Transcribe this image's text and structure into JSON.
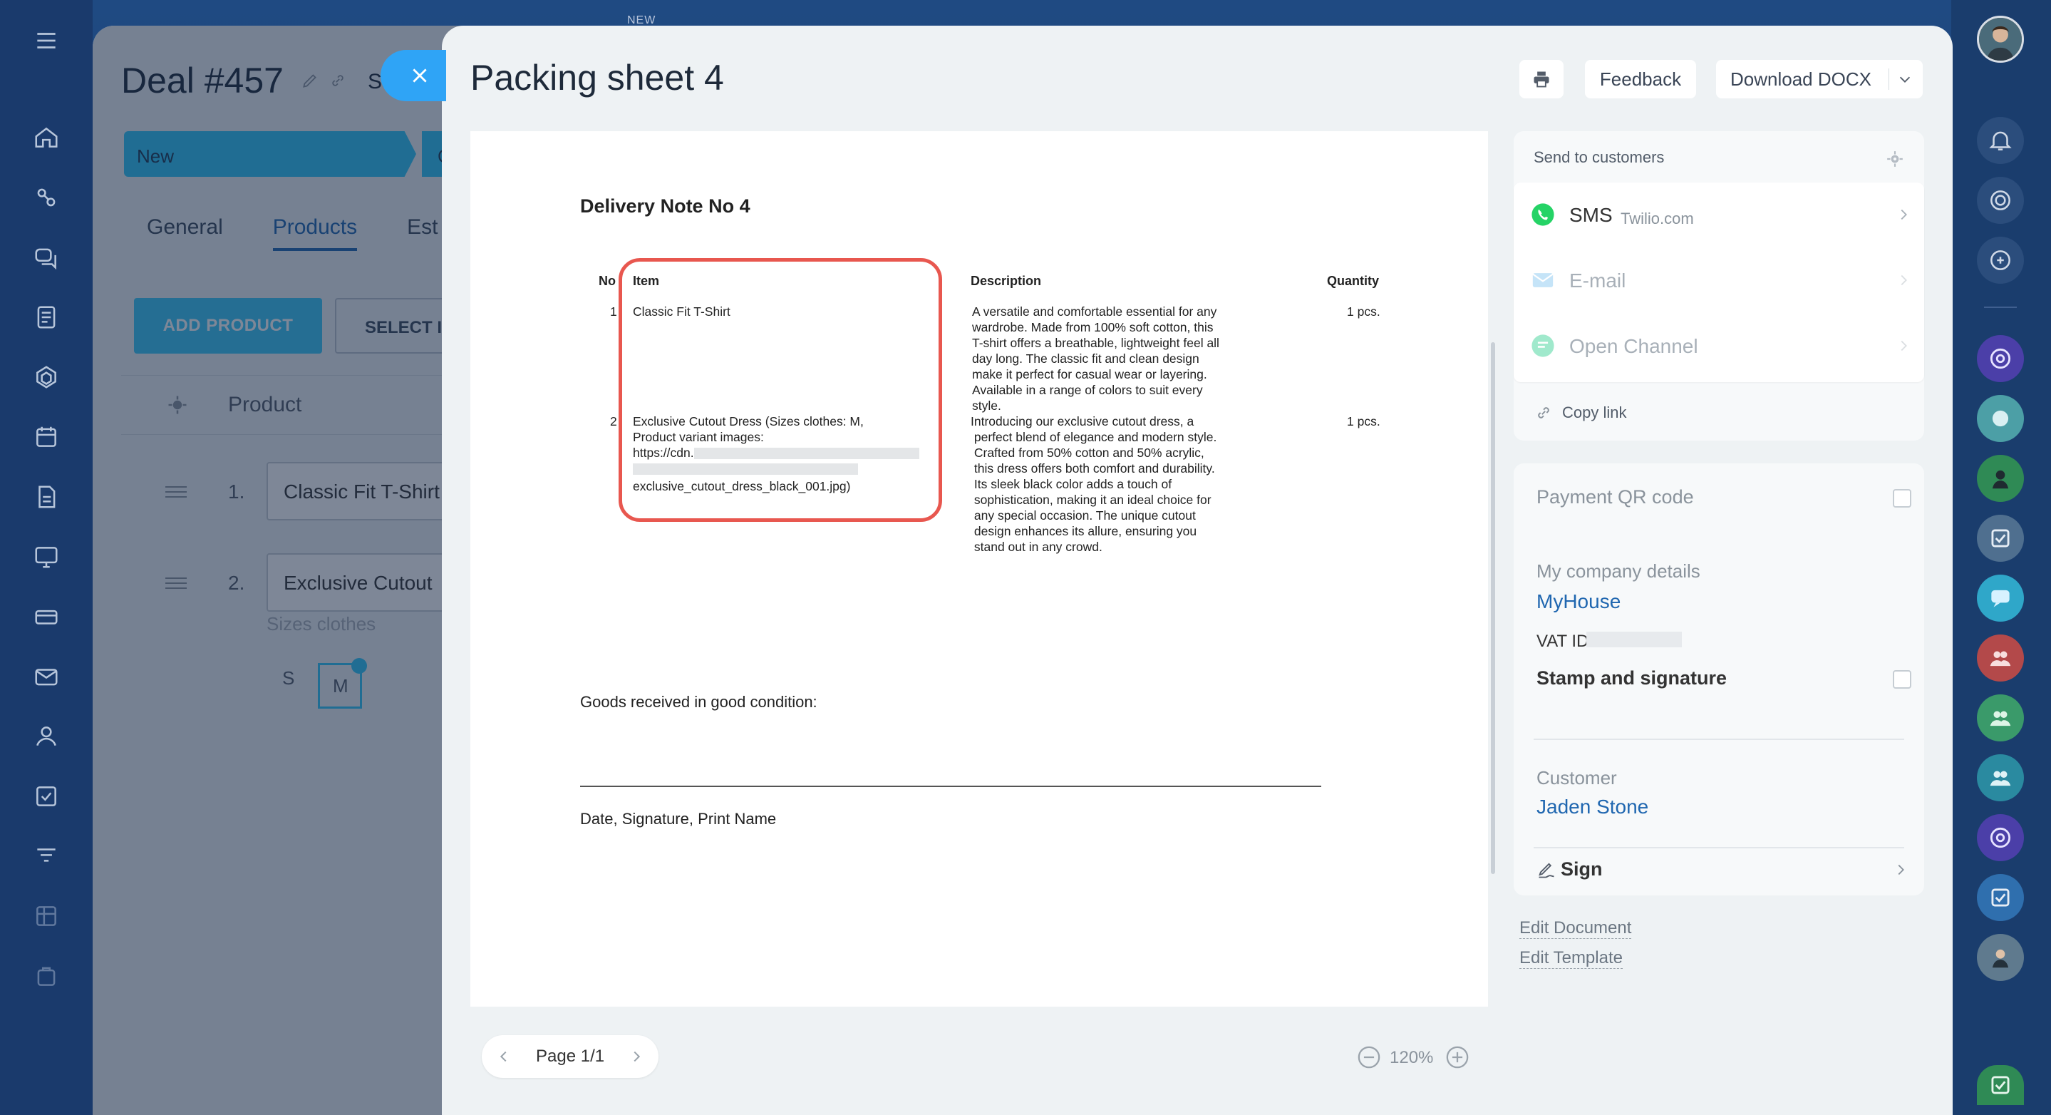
{
  "background": {
    "new_label": "NEW",
    "deal": {
      "title": "Deal #457",
      "title_suffix": "Sa",
      "stage_active": "New",
      "stage_next": "C",
      "tabs": [
        "General",
        "Products",
        "Est"
      ],
      "active_tab": "Products",
      "add_product": "ADD PRODUCT",
      "select_button": "SELECT I",
      "product_column": "Product",
      "rows": [
        {
          "num": "1.",
          "name": "Classic Fit T-Shirt"
        },
        {
          "num": "2.",
          "name": "Exclusive Cutout"
        }
      ],
      "sizes_label": "Sizes clothes",
      "sizes": [
        "S",
        "M"
      ],
      "selected_size": "M"
    }
  },
  "panel": {
    "title": "Packing sheet 4",
    "feedback": "Feedback",
    "download": "Download DOCX"
  },
  "document": {
    "title": "Delivery Note No 4",
    "columns": {
      "no": "No",
      "item": "Item",
      "description": "Description",
      "quantity": "Quantity"
    },
    "rows": [
      {
        "no": "1",
        "item": "Classic Fit T-Shirt",
        "description": [
          "A versatile and comfortable essential for any",
          "wardrobe. Made from 100% soft cotton, this",
          "T-shirt offers a breathable, lightweight feel all",
          "day long. The classic fit and clean design",
          "make it perfect for casual wear or layering.",
          "Available in a range of colors to suit every",
          "style."
        ],
        "quantity": "1 pcs."
      },
      {
        "no": "2",
        "item_lines": [
          "Exclusive Cutout Dress (Sizes clothes: M,",
          "Product variant images:",
          "https://cdn.",
          "exclusive_cutout_dress_black_001.jpg)"
        ],
        "description": [
          "Introducing our exclusive cutout dress, a",
          " perfect blend of elegance and modern style.",
          " Crafted from 50% cotton and 50% acrylic,",
          " this dress offers both comfort and durability.",
          " Its sleek black color adds a touch of",
          " sophistication, making it an ideal choice for",
          " any special occasion. The unique cutout",
          " design enhances its allure, ensuring you",
          " stand out in any crowd."
        ],
        "quantity": "1 pcs."
      }
    ],
    "goods_received": "Goods received in good condition:",
    "signature_caption": "Date, Signature, Print Name"
  },
  "pager": {
    "label": "Page 1/1",
    "zoom": "120%"
  },
  "send": {
    "heading": "Send to customers",
    "channels": [
      {
        "name": "SMS",
        "provider": "Twilio.com",
        "enabled": true
      },
      {
        "name": "E-mail",
        "provider": "",
        "enabled": false
      },
      {
        "name": "Open Channel",
        "provider": "",
        "enabled": false
      }
    ],
    "copy_link": "Copy link"
  },
  "details": {
    "payment_qr": "Payment QR code",
    "company_label": "My company details",
    "company_name": "MyHouse",
    "vat_label": "VAT ID",
    "stamp": "Stamp and signature",
    "customer_label": "Customer",
    "customer_name": "Jaden Stone",
    "sign": "Sign"
  },
  "links": {
    "edit_document": "Edit Document",
    "edit_template": "Edit Template"
  },
  "colors": {
    "accent": "#2067b0",
    "highlight": "#e8574f",
    "whatsapp": "#25d366",
    "stage": "#2fc6f6"
  }
}
